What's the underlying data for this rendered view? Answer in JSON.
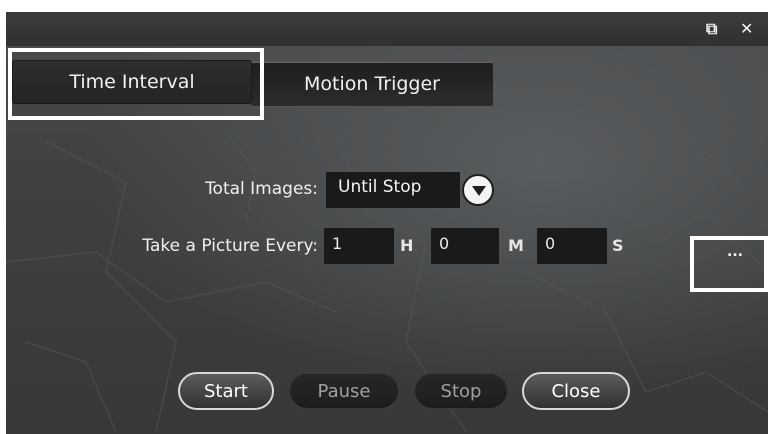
{
  "window": {
    "restore_icon": "restore-window-icon",
    "close_icon": "close-icon",
    "restore_glyph": "⧉",
    "close_glyph": "✕"
  },
  "tabs": [
    {
      "label": "Time Interval",
      "active": true
    },
    {
      "label": "Motion Trigger",
      "active": false
    }
  ],
  "form": {
    "total_images_label": "Total Images:",
    "total_images_value": "Until Stop",
    "interval_label": "Take a Picture Every:",
    "hours_value": "1",
    "hours_unit": "H",
    "minutes_value": "0",
    "minutes_unit": "M",
    "seconds_value": "0",
    "seconds_unit": "S",
    "more_options": "..."
  },
  "buttons": {
    "start": {
      "label": "Start",
      "enabled": true
    },
    "pause": {
      "label": "Pause",
      "enabled": false
    },
    "stop": {
      "label": "Stop",
      "enabled": false
    },
    "close": {
      "label": "Close",
      "enabled": true
    }
  },
  "colors": {
    "highlight": "#ffffff",
    "panel_background": "#3e4042",
    "input_background": "#1a1a1a"
  }
}
